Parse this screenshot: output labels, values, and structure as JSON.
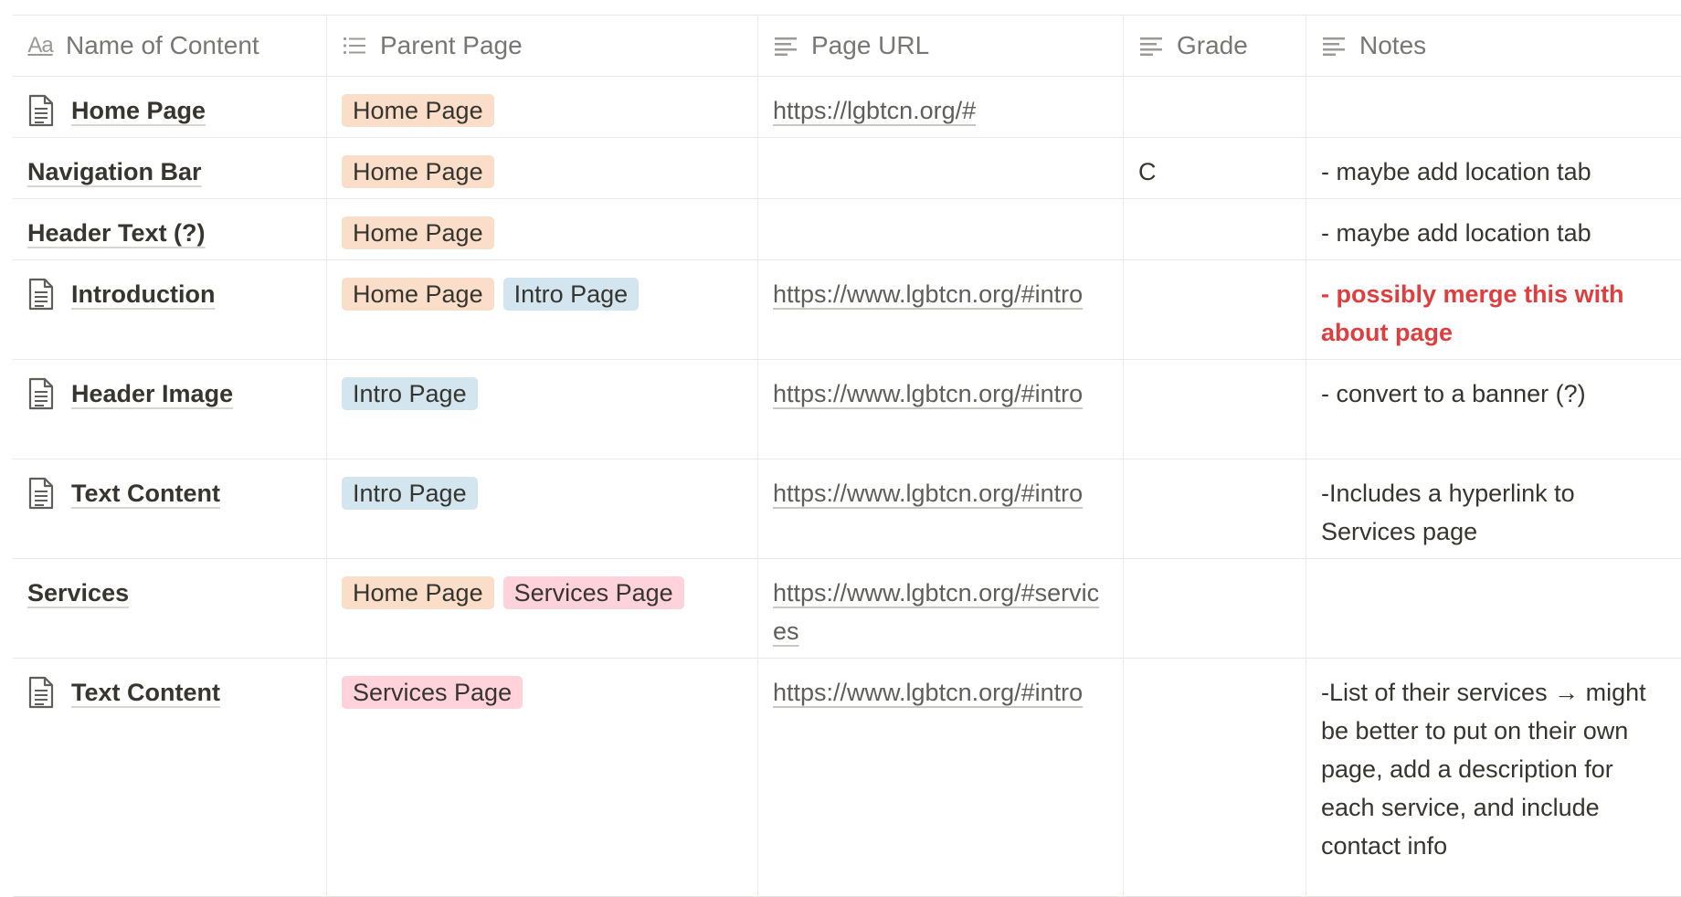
{
  "columns": {
    "name": "Name of Content",
    "parent": "Parent Page",
    "url": "Page URL",
    "grade": "Grade",
    "notes": "Notes",
    "name_icon_text": "Aa"
  },
  "rows": [
    {
      "name": "Home Page",
      "has_page_icon": true,
      "parents": [
        "Home Page"
      ],
      "url": "https://lgbtcn.org/#",
      "grade": "",
      "notes": ""
    },
    {
      "name": "Navigation Bar",
      "has_page_icon": false,
      "parents": [
        "Home Page"
      ],
      "url": "",
      "grade": "C",
      "notes": "- maybe add location tab"
    },
    {
      "name": "Header Text (?)",
      "has_page_icon": false,
      "parents": [
        "Home Page"
      ],
      "url": "",
      "grade": "",
      "notes": "- maybe add location tab"
    },
    {
      "name": "Introduction",
      "has_page_icon": true,
      "parents": [
        "Home Page",
        "Intro Page"
      ],
      "url": "https://www.lgbtcn.org/#intro",
      "grade": "",
      "notes": "- possibly merge this with about page",
      "notes_color": "#e03e3e"
    },
    {
      "name": "Header Image",
      "has_page_icon": true,
      "parents": [
        "Intro Page"
      ],
      "url": "https://www.lgbtcn.org/#intro",
      "grade": "",
      "notes": "- convert to a banner (?)"
    },
    {
      "name": "Text Content",
      "has_page_icon": true,
      "parents": [
        "Intro Page"
      ],
      "url": "https://www.lgbtcn.org/#intro",
      "grade": "",
      "notes": "-Includes a hyperlink to Services page"
    },
    {
      "name": "Services",
      "has_page_icon": false,
      "parents": [
        "Home Page",
        "Services Page"
      ],
      "url": "https://www.lgbtcn.org/#services",
      "grade": "",
      "notes": ""
    },
    {
      "name": "Text Content",
      "has_page_icon": true,
      "parents": [
        "Services Page"
      ],
      "url": "https://www.lgbtcn.org/#intro",
      "grade": "",
      "notes": "-List of their services → might be better to put on their own page, add a description for each service, and include contact info"
    }
  ],
  "tag_colors": {
    "Home Page": "#fadec9",
    "Intro Page": "#d3e5ef",
    "Services Page": "#ffd2dc"
  }
}
